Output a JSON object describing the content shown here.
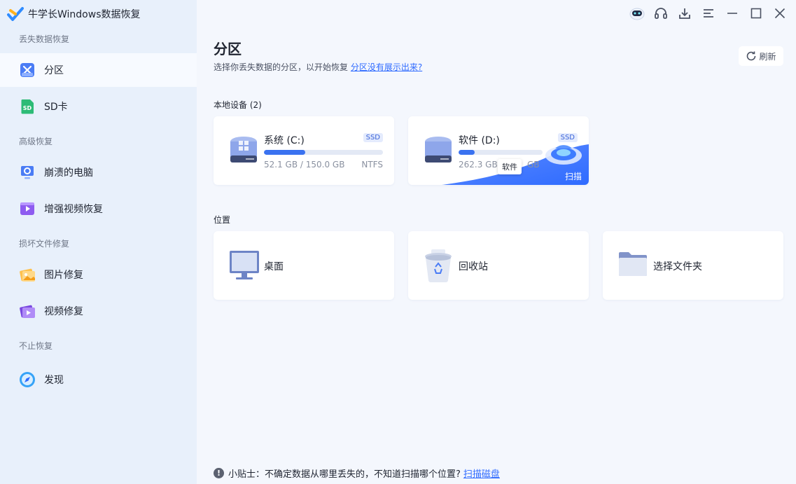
{
  "app": {
    "title": "牛学长Windows数据恢复"
  },
  "sidebar": {
    "sections": [
      {
        "label": "丢失数据恢复"
      },
      {
        "label": "高级恢复"
      },
      {
        "label": "损坏文件修复"
      },
      {
        "label": "不止恢复"
      }
    ],
    "items": [
      {
        "label": "分区",
        "icon": "partition-icon",
        "active": true
      },
      {
        "label": "SD卡",
        "icon": "sd-card-icon"
      },
      {
        "label": "崩溃的电脑",
        "icon": "crashed-pc-icon"
      },
      {
        "label": "增强视频恢复",
        "icon": "enhanced-video-icon"
      },
      {
        "label": "图片修复",
        "icon": "photo-repair-icon"
      },
      {
        "label": "视频修复",
        "icon": "video-repair-icon"
      },
      {
        "label": "发现",
        "icon": "compass-icon"
      }
    ]
  },
  "window_controls": [
    "assistant-robot-icon",
    "headset-icon",
    "download-icon",
    "menu-icon",
    "minimize-icon",
    "maximize-icon",
    "close-icon"
  ],
  "main": {
    "title": "分区",
    "subtitle": "选择你丢失数据的分区，以开始恢复",
    "subtitle_link": "分区没有展示出来?",
    "refresh_label": "刷新",
    "local_devices_label": "本地设备 (2)",
    "drives": [
      {
        "name": "系统 (C:)",
        "badge": "SSD",
        "size": "52.1 GB / 150.0 GB",
        "fs": "NTFS",
        "used_fraction": 0.347
      },
      {
        "name": "软件 (D:)",
        "badge": "SSD",
        "size": "262.3 GB",
        "size_tail": "GB",
        "fs": "",
        "used_fraction": 0.19,
        "tooltip": "软件",
        "scan_label": "扫描"
      }
    ],
    "locations_label": "位置",
    "locations": [
      {
        "name": "桌面",
        "icon": "desktop-monitor-icon"
      },
      {
        "name": "回收站",
        "icon": "recycle-bin-icon"
      },
      {
        "name": "选择文件夹",
        "icon": "folder-icon"
      }
    ],
    "footer_tip": "小贴士：不确定数据从哪里丢失的，不知道扫描哪个位置?",
    "footer_link": "扫描磁盘"
  },
  "colors": {
    "accent": "#2f6bff",
    "sidebar_bg": "#e8f0fb",
    "main_bg": "#f4f7fd"
  }
}
